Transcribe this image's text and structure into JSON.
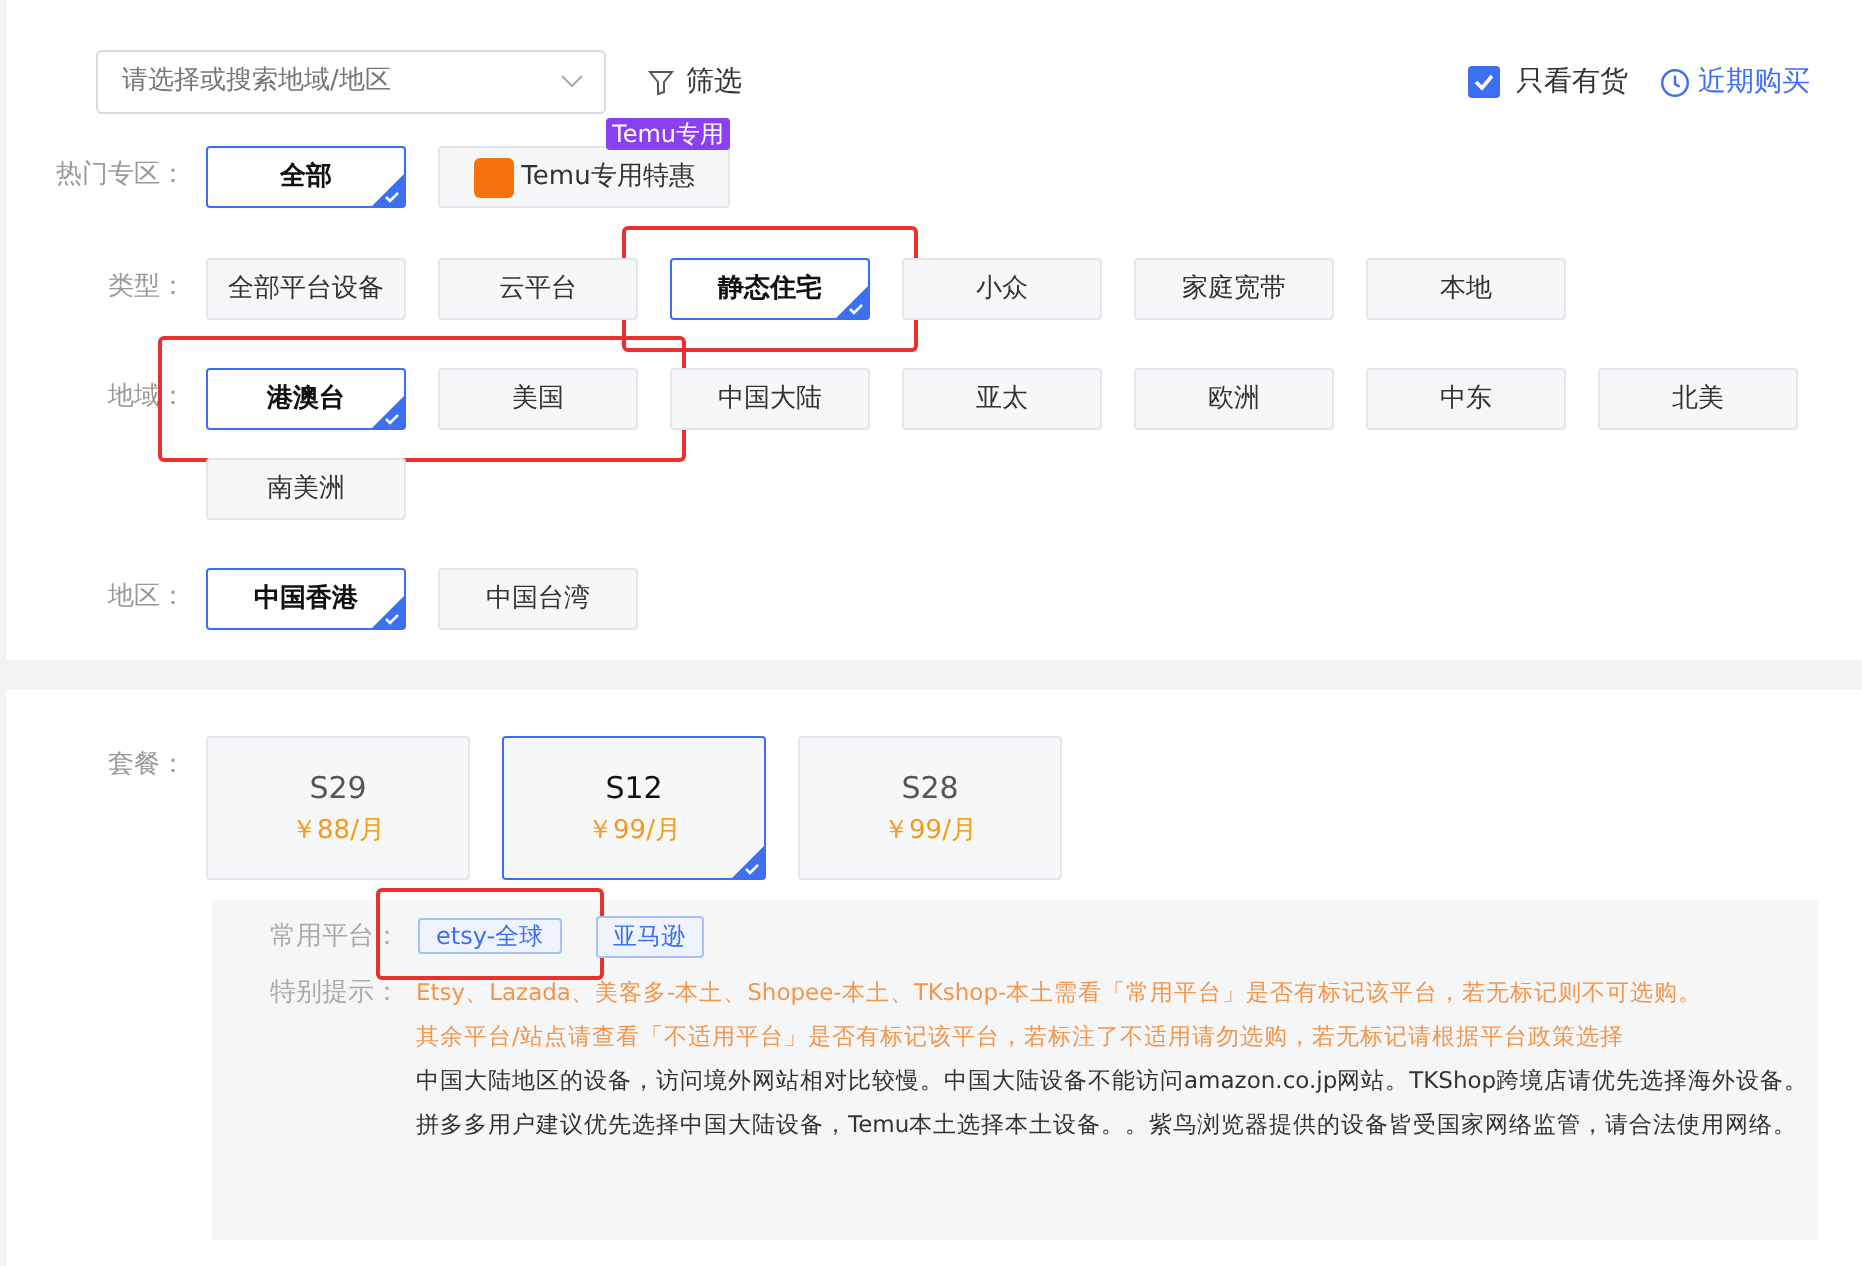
{
  "search": {
    "placeholder": "请选择或搜索地域/地区"
  },
  "filter_button": "筛选",
  "in_stock_only": {
    "label": "只看有货",
    "checked": true
  },
  "recent_link": "近期购买",
  "filter_rows": [
    {
      "label": "热门专区：",
      "options": [
        {
          "label": "全部",
          "selected": true,
          "highlighted": false,
          "kind": "plain"
        },
        {
          "label": "Temu专用特惠",
          "selected": false,
          "highlighted": false,
          "kind": "logo",
          "badge": "Temu专用"
        }
      ]
    },
    {
      "label": "类型：",
      "options": [
        {
          "label": "全部平台设备",
          "selected": false,
          "highlighted": false,
          "kind": "plain"
        },
        {
          "label": "云平台",
          "selected": false,
          "highlighted": false,
          "kind": "plain"
        },
        {
          "label": "静态住宅",
          "selected": true,
          "highlighted": true,
          "kind": "plain"
        },
        {
          "label": "小众",
          "selected": false,
          "highlighted": false,
          "kind": "plain"
        },
        {
          "label": "家庭宽带",
          "selected": false,
          "highlighted": false,
          "kind": "plain"
        },
        {
          "label": "本地",
          "selected": false,
          "highlighted": false,
          "kind": "plain"
        }
      ]
    },
    {
      "label": "地域：",
      "options": [
        {
          "label": "港澳台",
          "selected": true,
          "highlighted": true,
          "kind": "plain"
        },
        {
          "label": "美国",
          "selected": false,
          "highlighted": true,
          "kind": "plain"
        },
        {
          "label": "中国大陆",
          "selected": false,
          "highlighted": false,
          "kind": "plain"
        },
        {
          "label": "亚太",
          "selected": false,
          "highlighted": false,
          "kind": "plain"
        },
        {
          "label": "欧洲",
          "selected": false,
          "highlighted": false,
          "kind": "plain"
        },
        {
          "label": "中东",
          "selected": false,
          "highlighted": false,
          "kind": "plain"
        },
        {
          "label": "北美",
          "selected": false,
          "highlighted": false,
          "kind": "plain"
        },
        {
          "label": "南美洲",
          "selected": false,
          "highlighted": false,
          "kind": "plain"
        }
      ]
    },
    {
      "label": "地区：",
      "options": [
        {
          "label": "中国香港",
          "selected": true,
          "highlighted": false,
          "kind": "plain"
        },
        {
          "label": "中国台湾",
          "selected": false,
          "highlighted": false,
          "kind": "plain"
        }
      ]
    }
  ],
  "packages": {
    "label": "套餐：",
    "items": [
      {
        "name": "S29",
        "price": "￥88/月",
        "selected": false
      },
      {
        "name": "S12",
        "price": "￥99/月",
        "selected": true
      },
      {
        "name": "S28",
        "price": "￥99/月",
        "selected": false
      }
    ]
  },
  "platforms": {
    "label": "常用平台：",
    "tags": [
      {
        "label": "etsy-全球",
        "highlighted": true
      },
      {
        "label": "亚马逊",
        "highlighted": false
      }
    ]
  },
  "notes": {
    "label": "特别提示：",
    "items": [
      {
        "kind": "warning",
        "text": "Etsy、Lazada、美客多-本土、Shopee-本土、TKshop-本土需看「常用平台」是否有标记该平台，若无标记则不可选购。"
      },
      {
        "kind": "warning",
        "text": "其余平台/站点请查看「不适用平台」是否有标记该平台，若标注了不适用请勿选购，若无标记请根据平台政策选择"
      },
      {
        "kind": "info",
        "text": "中国大陆地区的设备，访问境外网站相对比较慢。中国大陆设备不能访问amazon.co.jp网站。TKShop跨境店请优先选择海外设备。拼多多用户建议优先选择中国大陆设备，Temu本土选择本土设备。。紫鸟浏览器提供的设备皆受国家网络监管，请合法使用网络。"
      }
    ]
  }
}
